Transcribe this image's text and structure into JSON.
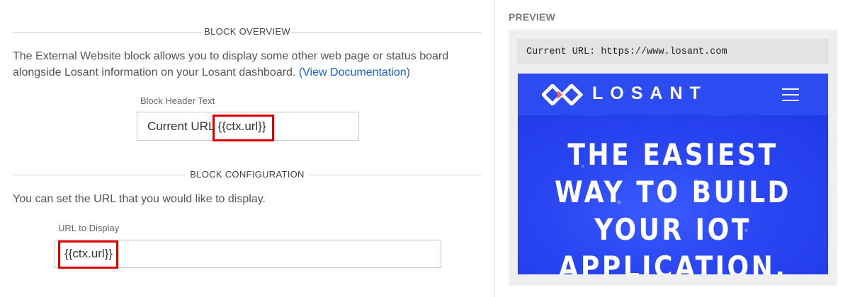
{
  "overview": {
    "section_label": "BLOCK OVERVIEW",
    "description": "The External Website block allows you to display some other web page or status board alongside Losant information on your Losant dashboard.",
    "doc_link": "(View Documentation)"
  },
  "header_field": {
    "label": "Block Header Text",
    "value_prefix": "Current URL ",
    "value_template": "{{ctx.url}}"
  },
  "configuration": {
    "section_label": "BLOCK CONFIGURATION",
    "description": "You can set the URL that you would like to display."
  },
  "url_field": {
    "label": "URL to Display",
    "value": "{{ctx.url}}"
  },
  "preview": {
    "title": "PREVIEW",
    "header_text": "Current URL: https://www.losant.com",
    "site": {
      "brand": "LOSANT",
      "hero_lines": [
        "THE EASIEST",
        "WAY TO BUILD",
        "YOUR IOT",
        "APPLICATION."
      ],
      "logo_icon": "losant-logo-icon",
      "menu_icon": "hamburger-menu-icon"
    }
  },
  "colors": {
    "link": "#1a5fd6",
    "highlight": "#e00000",
    "site_blue": "#2c4bf0"
  }
}
